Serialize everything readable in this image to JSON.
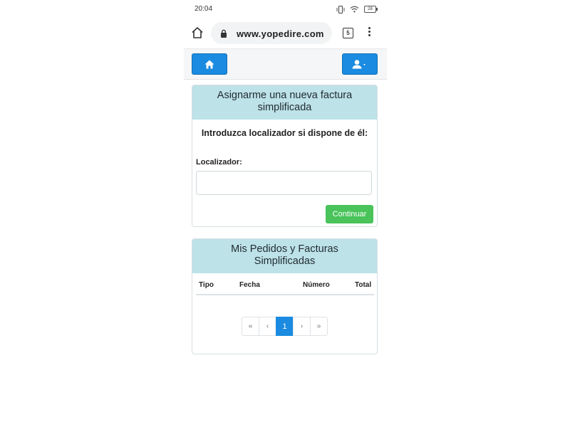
{
  "status_bar": {
    "time": "20:04",
    "battery": "28",
    "vibrate_icon": "vibrate-icon",
    "wifi_icon": "wifi-icon"
  },
  "browser": {
    "url": "www.yopedire.com",
    "tab_count": "5"
  },
  "navbar": {
    "home_icon": "home-icon",
    "user_icon": "user-dropdown-icon",
    "accent": "#1a8be0"
  },
  "assign_card": {
    "title": "Asignarme una nueva factura simplificada",
    "intro": "Introduzca localizador si dispone de él:",
    "locator_label": "Localizador:",
    "locator_value": "",
    "continue_label": "Continuar",
    "continue_color": "#49c35a"
  },
  "orders_card": {
    "title": "Mis Pedidos y Facturas Simplificadas",
    "columns": [
      "Tipo",
      "Fecha",
      "Número",
      "Total"
    ],
    "rows": [],
    "pagination": {
      "first": "«",
      "prev": "‹",
      "current": "1",
      "next": "›",
      "last": "»"
    }
  },
  "header_color": "#bde2e8"
}
